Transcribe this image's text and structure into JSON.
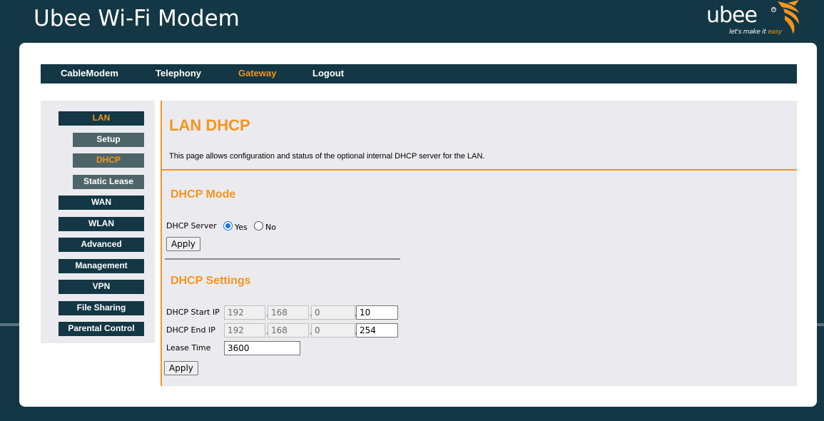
{
  "app": {
    "title": "Ubee Wi-Fi Modem"
  },
  "logo": {
    "word": "ubee",
    "reg": "R",
    "tagline_prefix": "let's make it ",
    "tagline_accent": "easy"
  },
  "topnav": {
    "items": [
      {
        "label": "CableModem",
        "active": false
      },
      {
        "label": "Telephony",
        "active": false
      },
      {
        "label": "Gateway",
        "active": true
      },
      {
        "label": "Logout",
        "active": false
      }
    ]
  },
  "sidebar": {
    "items": [
      {
        "label": "LAN",
        "level": "main",
        "active": true
      },
      {
        "label": "Setup",
        "level": "sub",
        "active": false
      },
      {
        "label": "DHCP",
        "level": "sub",
        "active": true
      },
      {
        "label": "Static Lease",
        "level": "sub",
        "active": false
      },
      {
        "label": "WAN",
        "level": "main",
        "active": false
      },
      {
        "label": "WLAN",
        "level": "main",
        "active": false
      },
      {
        "label": "Advanced",
        "level": "main",
        "active": false
      },
      {
        "label": "Management",
        "level": "main",
        "active": false
      },
      {
        "label": "VPN",
        "level": "main",
        "active": false
      },
      {
        "label": "File Sharing",
        "level": "main",
        "active": false
      },
      {
        "label": "Parental Control",
        "level": "main",
        "active": false
      }
    ]
  },
  "page": {
    "title": "LAN DHCP",
    "description": "This page allows configuration and status of the optional internal DHCP server for the LAN."
  },
  "dhcp_mode": {
    "title": "DHCP Mode",
    "server_label": "DHCP Server",
    "yes_label": "Yes",
    "no_label": "No",
    "selected": "Yes",
    "apply_label": "Apply"
  },
  "dhcp_settings": {
    "title": "DHCP Settings",
    "start_ip_label": "DHCP Start IP",
    "start_ip": [
      "192",
      "168",
      "0",
      "10"
    ],
    "end_ip_label": "DHCP End IP",
    "end_ip": [
      "192",
      "168",
      "0",
      "254"
    ],
    "lease_label": "Lease Time",
    "lease_value": "3600",
    "apply_label": "Apply"
  },
  "colors": {
    "navy": "#133744",
    "accent": "#f7941d",
    "sub_nav": "#4d6569",
    "panel": "#ebebef"
  }
}
